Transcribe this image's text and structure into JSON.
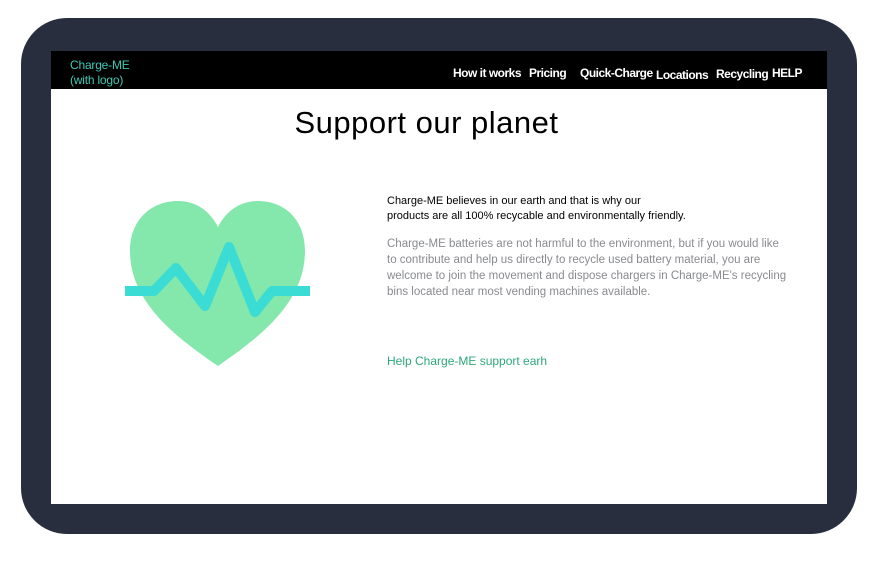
{
  "header": {
    "logo_line1": "Charge-ME",
    "logo_line2": "(with logo)",
    "nav": [
      {
        "label": "How it works"
      },
      {
        "label": "Pricing"
      },
      {
        "label": "Quick-Charge"
      },
      {
        "label": "Locations"
      },
      {
        "label": "Recycling"
      },
      {
        "label": "HELP"
      }
    ]
  },
  "main": {
    "title": "Support our planet",
    "intro_line1": "Charge-ME believes in our earth and that is why our",
    "intro_line2": "products are all 100% recycable and environmentally friendly.",
    "details": "Charge-ME batteries are not harmful to the environment, but if you would like to contribute and help us directly to recycle used battery material, you are welcome to join the movement and dispose chargers in Charge-ME's recycling bins located near most vending machines available.",
    "cta_link": "Help Charge-ME support earh"
  },
  "colors": {
    "device_frame": "#282e3d",
    "navbar_bg": "#000000",
    "logo_text": "#3ec8b4",
    "heart_fill": "#84e8ac",
    "pulse_line": "#3bdcd4",
    "details_text": "#898a8e",
    "link_text": "#2ea87a"
  },
  "icons": {
    "illustration": "heart-pulse-icon"
  }
}
